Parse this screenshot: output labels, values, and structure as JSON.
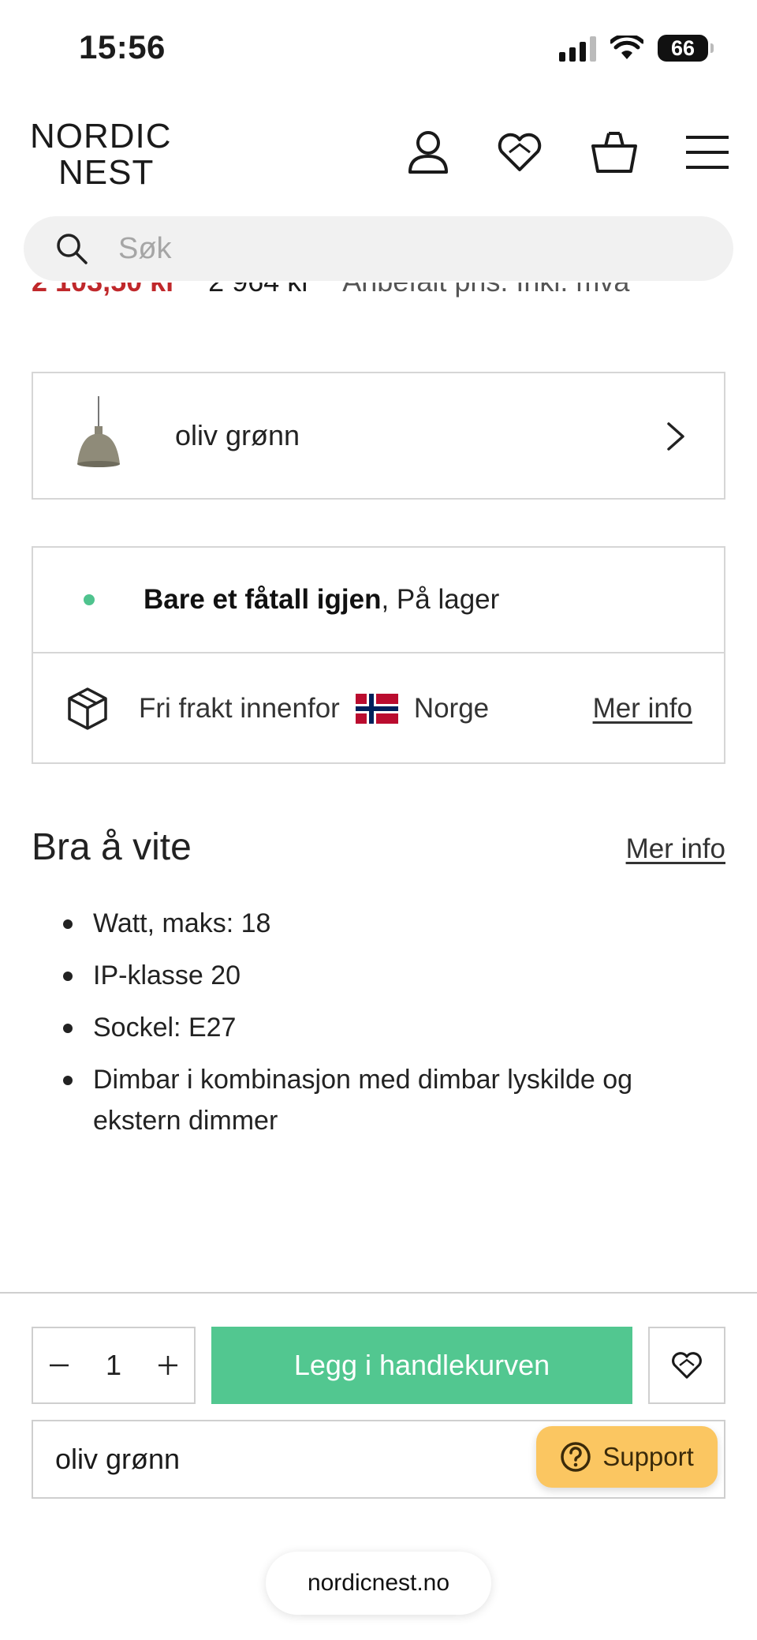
{
  "status_bar": {
    "time": "15:56",
    "battery": "66"
  },
  "header": {
    "logo_line1": "NORDIC",
    "logo_line2": "NEST",
    "icons": [
      "user-icon",
      "heart-icon",
      "basket-icon",
      "menu-icon"
    ]
  },
  "search": {
    "placeholder": "Søk"
  },
  "price": {
    "sale": "2 103,50 kr",
    "original": "2 964 kr",
    "note": "Anbefalt pris. Inkl. mva"
  },
  "variant": {
    "label": "oliv grønn"
  },
  "stock": {
    "status_bold": "Bare et fåtall igjen",
    "status_rest": ", På lager",
    "indicator_color": "#4fc38e",
    "shipping_text": "Fri frakt innenfor",
    "country": "Norge",
    "more_info": "Mer info"
  },
  "good_to_know": {
    "title": "Bra å vite",
    "more_info": "Mer info",
    "items": [
      "Watt, maks: 18",
      "IP-klasse 20",
      "Sockel: E27",
      "Dimbar i kombinasjon med dimbar lyskilde og ekstern dimmer"
    ]
  },
  "bottom_bar": {
    "quantity": "1",
    "add_to_cart": "Legg i handlekurven",
    "add_button_color": "#52c790",
    "selected_variant": "oliv grønn",
    "support_label": "Support",
    "support_color": "#fbc661"
  },
  "browser": {
    "url": "nordicnest.no"
  }
}
